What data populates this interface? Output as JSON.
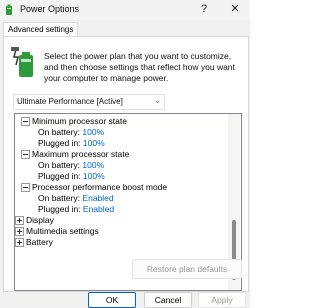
{
  "window": {
    "title": "Power Options",
    "help_glyph": "?",
    "close_glyph": "✕"
  },
  "tabs": [
    {
      "label": "Advanced settings"
    }
  ],
  "intro": {
    "text": "Select the power plan that you want to customize, and then choose settings that reflect how you want your computer to manage power."
  },
  "plan": {
    "selected": "Ultimate Performance [Active]",
    "chevron": "⌄"
  },
  "tree": {
    "items": [
      {
        "label": "Minimum processor state",
        "expanded": true
      },
      {
        "label": "On battery:",
        "value": "100%"
      },
      {
        "label": "Plugged in:",
        "value": "100%"
      },
      {
        "label": "Maximum processor state",
        "expanded": true
      },
      {
        "label": "On battery:",
        "value": "100%"
      },
      {
        "label": "Plugged in:",
        "value": "100%"
      },
      {
        "label": "Processor performance boost mode",
        "expanded": true
      },
      {
        "label": "On battery:",
        "value": "Enabled"
      },
      {
        "label": "Plugged in:",
        "value": "Enabled"
      },
      {
        "label": "Display",
        "expanded": false
      },
      {
        "label": "Multimedia settings",
        "expanded": false
      },
      {
        "label": "Battery",
        "expanded": false
      }
    ]
  },
  "restore_label": "Restore plan defaults",
  "buttons": {
    "ok": "OK",
    "cancel": "Cancel",
    "apply": "Apply"
  },
  "colors": {
    "value_link": "#0066cc",
    "primary_border": "#0067c0"
  }
}
